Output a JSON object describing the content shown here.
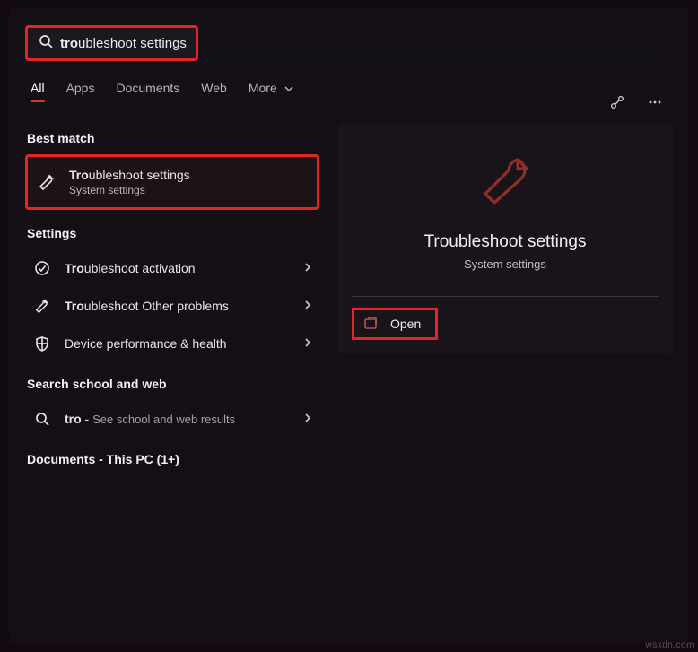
{
  "search": {
    "query_bold": "tro",
    "query_rest": "ubleshoot settings"
  },
  "tabs": {
    "all": "All",
    "apps": "Apps",
    "documents": "Documents",
    "web": "Web",
    "more": "More"
  },
  "sections": {
    "best_match": "Best match",
    "settings": "Settings",
    "search_web": "Search school and web",
    "documents": "Documents - This PC (1+)"
  },
  "best_match_item": {
    "title_bold": "Tro",
    "title_rest": "ubleshoot settings",
    "sub": "System settings"
  },
  "settings_items": [
    {
      "title_bold": "Tro",
      "title_rest": "ubleshoot activation",
      "icon": "check"
    },
    {
      "title_bold": "Tro",
      "title_rest": "ubleshoot Other problems",
      "icon": "wrench"
    },
    {
      "title_bold": "",
      "title_rest": "Device performance & health",
      "icon": "shield"
    }
  ],
  "web_item": {
    "title_bold": "tro",
    "tail": " - ",
    "hint": "See school and web results"
  },
  "preview": {
    "title": "Troubleshoot settings",
    "sub": "System settings",
    "open": "Open"
  },
  "watermark": "wsxdn.com"
}
